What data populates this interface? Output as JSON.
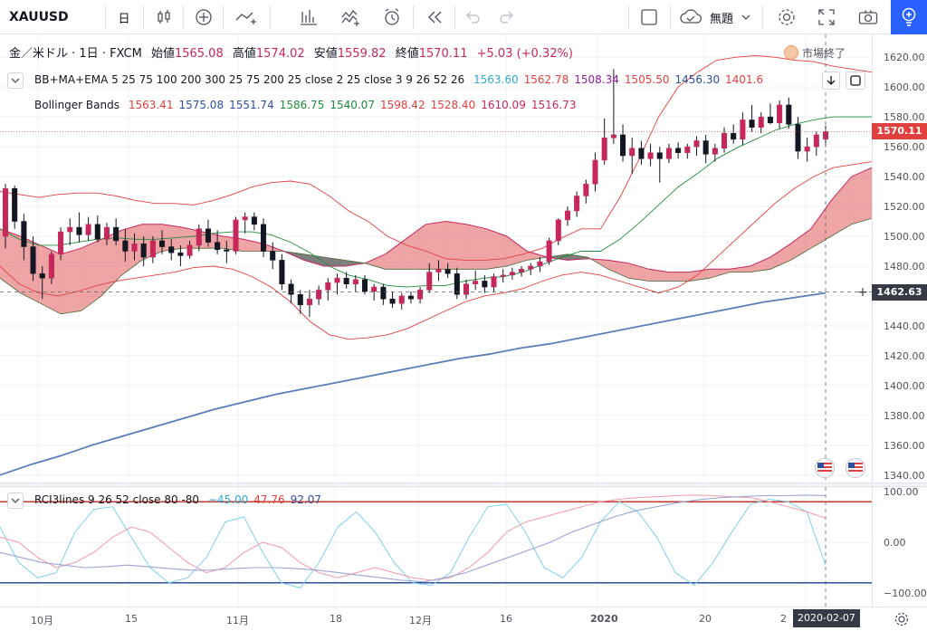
{
  "toolbar": {
    "symbol": "XAUUSD",
    "interval": "日",
    "template_label": "無題",
    "icons": [
      "candles-icon",
      "add-indicator-icon",
      "compare-icon",
      "bars-icon",
      "replay-icon",
      "alert-icon",
      "rewind-icon",
      "undo-icon",
      "redo-icon",
      "layout-icon",
      "cloud-save-icon",
      "settings-icon",
      "fullscreen-icon",
      "screenshot-icon",
      "ideas-icon"
    ]
  },
  "header": {
    "title": "金／米ドル · 1日 · FXCM",
    "open_label": "始値",
    "open": "1565.08",
    "high_label": "高値",
    "high": "1574.02",
    "low_label": "安値",
    "low": "1559.82",
    "close_label": "終値",
    "close": "1570.11",
    "change": "+5.03 (+0.32%)",
    "market_status": "市場終了"
  },
  "indicators": {
    "bbmaema": {
      "label": "BB+MA+EMA 5 25 75 100 200 300 25 75 200 25 close 2 25 close 3 9 26 52 26",
      "values": [
        {
          "v": "1563.60",
          "color": "#2ea8d3"
        },
        {
          "v": "1562.78",
          "color": "#e0413f"
        },
        {
          "v": "1508.34",
          "color": "#8c1fa0"
        },
        {
          "v": "1505.50",
          "color": "#e0413f"
        },
        {
          "v": "1456.30",
          "color": "#2e4fa0"
        },
        {
          "v": "1401.6",
          "color": "#e0413f"
        }
      ]
    },
    "bollinger": {
      "label": "Bollinger Bands",
      "values": [
        {
          "v": "1563.41",
          "color": "#e0413f"
        },
        {
          "v": "1575.08",
          "color": "#2e4fa0"
        },
        {
          "v": "1551.74",
          "color": "#2e4fa0"
        },
        {
          "v": "1586.75",
          "color": "#1e8c3c"
        },
        {
          "v": "1540.07",
          "color": "#1e8c3c"
        },
        {
          "v": "1598.42",
          "color": "#e0413f"
        },
        {
          "v": "1528.40",
          "color": "#e0413f"
        },
        {
          "v": "1610.09",
          "color": "#c6285c"
        },
        {
          "v": "1516.73",
          "color": "#c6285c"
        }
      ]
    },
    "rci": {
      "label": "RCI3lines 9 26 52 close 80 -80",
      "values": [
        {
          "v": "−45.00",
          "color": "#2ea8d3"
        },
        {
          "v": "47.76",
          "color": "#e0413f"
        },
        {
          "v": "92.07",
          "color": "#2e4fa0"
        }
      ]
    }
  },
  "price_axis": {
    "ticks": [
      "1620.00",
      "1600.00",
      "1580.00",
      "1560.00",
      "1540.00",
      "1520.00",
      "1500.00",
      "1480.00",
      "1460.00",
      "1440.00",
      "1420.00",
      "1400.00",
      "1380.00",
      "1360.00",
      "1340.00"
    ],
    "last_price": "1570.11",
    "crosshair_price": "1462.63"
  },
  "rci_axis": {
    "ticks": [
      "100.00",
      "0.00",
      "−100.00"
    ]
  },
  "time_axis": {
    "ticks": [
      "10月",
      "15",
      "11月",
      "18",
      "12月",
      "16",
      "2020",
      "20",
      "2"
    ],
    "crosshair_date": "2020-02-07"
  },
  "chart_data": {
    "type": "candlestick",
    "symbol": "XAUUSD",
    "ylim": [
      1335,
      1628
    ],
    "candles": [
      {
        "o": 1500,
        "h": 1535,
        "l": 1492,
        "c": 1532
      },
      {
        "o": 1532,
        "h": 1534,
        "l": 1505,
        "c": 1510
      },
      {
        "o": 1510,
        "h": 1515,
        "l": 1484,
        "c": 1493
      },
      {
        "o": 1493,
        "h": 1500,
        "l": 1470,
        "c": 1475
      },
      {
        "o": 1475,
        "h": 1480,
        "l": 1458,
        "c": 1472
      },
      {
        "o": 1472,
        "h": 1490,
        "l": 1468,
        "c": 1488
      },
      {
        "o": 1488,
        "h": 1506,
        "l": 1484,
        "c": 1503
      },
      {
        "o": 1503,
        "h": 1512,
        "l": 1494,
        "c": 1506
      },
      {
        "o": 1506,
        "h": 1516,
        "l": 1496,
        "c": 1501
      },
      {
        "o": 1501,
        "h": 1513,
        "l": 1497,
        "c": 1508
      },
      {
        "o": 1508,
        "h": 1514,
        "l": 1496,
        "c": 1498
      },
      {
        "o": 1498,
        "h": 1509,
        "l": 1494,
        "c": 1506
      },
      {
        "o": 1506,
        "h": 1512,
        "l": 1494,
        "c": 1497
      },
      {
        "o": 1497,
        "h": 1505,
        "l": 1483,
        "c": 1490
      },
      {
        "o": 1490,
        "h": 1502,
        "l": 1484,
        "c": 1495
      },
      {
        "o": 1495,
        "h": 1500,
        "l": 1480,
        "c": 1486
      },
      {
        "o": 1486,
        "h": 1500,
        "l": 1482,
        "c": 1497
      },
      {
        "o": 1497,
        "h": 1504,
        "l": 1488,
        "c": 1493
      },
      {
        "o": 1493,
        "h": 1498,
        "l": 1484,
        "c": 1489
      },
      {
        "o": 1489,
        "h": 1494,
        "l": 1480,
        "c": 1487
      },
      {
        "o": 1487,
        "h": 1497,
        "l": 1485,
        "c": 1494
      },
      {
        "o": 1494,
        "h": 1508,
        "l": 1490,
        "c": 1505
      },
      {
        "o": 1505,
        "h": 1511,
        "l": 1493,
        "c": 1496
      },
      {
        "o": 1496,
        "h": 1504,
        "l": 1488,
        "c": 1491
      },
      {
        "o": 1491,
        "h": 1497,
        "l": 1482,
        "c": 1490
      },
      {
        "o": 1490,
        "h": 1513,
        "l": 1488,
        "c": 1511
      },
      {
        "o": 1511,
        "h": 1516,
        "l": 1502,
        "c": 1513
      },
      {
        "o": 1513,
        "h": 1516,
        "l": 1504,
        "c": 1508
      },
      {
        "o": 1508,
        "h": 1512,
        "l": 1486,
        "c": 1490
      },
      {
        "o": 1490,
        "h": 1496,
        "l": 1478,
        "c": 1484
      },
      {
        "o": 1484,
        "h": 1488,
        "l": 1464,
        "c": 1468
      },
      {
        "o": 1468,
        "h": 1471,
        "l": 1455,
        "c": 1461
      },
      {
        "o": 1461,
        "h": 1464,
        "l": 1448,
        "c": 1454
      },
      {
        "o": 1454,
        "h": 1464,
        "l": 1446,
        "c": 1458
      },
      {
        "o": 1458,
        "h": 1467,
        "l": 1454,
        "c": 1464
      },
      {
        "o": 1464,
        "h": 1472,
        "l": 1457,
        "c": 1469
      },
      {
        "o": 1469,
        "h": 1475,
        "l": 1461,
        "c": 1472
      },
      {
        "o": 1472,
        "h": 1476,
        "l": 1465,
        "c": 1468
      },
      {
        "o": 1468,
        "h": 1474,
        "l": 1463,
        "c": 1471
      },
      {
        "o": 1471,
        "h": 1474,
        "l": 1461,
        "c": 1463
      },
      {
        "o": 1463,
        "h": 1468,
        "l": 1457,
        "c": 1466
      },
      {
        "o": 1466,
        "h": 1468,
        "l": 1454,
        "c": 1458
      },
      {
        "o": 1458,
        "h": 1463,
        "l": 1452,
        "c": 1455
      },
      {
        "o": 1455,
        "h": 1462,
        "l": 1451,
        "c": 1460
      },
      {
        "o": 1460,
        "h": 1463,
        "l": 1455,
        "c": 1458
      },
      {
        "o": 1458,
        "h": 1466,
        "l": 1455,
        "c": 1464
      },
      {
        "o": 1464,
        "h": 1482,
        "l": 1462,
        "c": 1476
      },
      {
        "o": 1476,
        "h": 1484,
        "l": 1470,
        "c": 1478
      },
      {
        "o": 1478,
        "h": 1482,
        "l": 1472,
        "c": 1475
      },
      {
        "o": 1475,
        "h": 1479,
        "l": 1458,
        "c": 1461
      },
      {
        "o": 1461,
        "h": 1471,
        "l": 1458,
        "c": 1468
      },
      {
        "o": 1468,
        "h": 1477,
        "l": 1464,
        "c": 1470
      },
      {
        "o": 1470,
        "h": 1474,
        "l": 1462,
        "c": 1466
      },
      {
        "o": 1466,
        "h": 1475,
        "l": 1463,
        "c": 1473
      },
      {
        "o": 1473,
        "h": 1478,
        "l": 1469,
        "c": 1474
      },
      {
        "o": 1474,
        "h": 1479,
        "l": 1471,
        "c": 1476
      },
      {
        "o": 1476,
        "h": 1480,
        "l": 1473,
        "c": 1478
      },
      {
        "o": 1478,
        "h": 1482,
        "l": 1474,
        "c": 1480
      },
      {
        "o": 1480,
        "h": 1486,
        "l": 1476,
        "c": 1483
      },
      {
        "o": 1483,
        "h": 1499,
        "l": 1481,
        "c": 1497
      },
      {
        "o": 1497,
        "h": 1512,
        "l": 1494,
        "c": 1511
      },
      {
        "o": 1511,
        "h": 1520,
        "l": 1507,
        "c": 1517
      },
      {
        "o": 1517,
        "h": 1530,
        "l": 1513,
        "c": 1527
      },
      {
        "o": 1527,
        "h": 1538,
        "l": 1522,
        "c": 1535
      },
      {
        "o": 1535,
        "h": 1556,
        "l": 1530,
        "c": 1551
      },
      {
        "o": 1551,
        "h": 1579,
        "l": 1548,
        "c": 1566
      },
      {
        "o": 1566,
        "h": 1612,
        "l": 1562,
        "c": 1568
      },
      {
        "o": 1568,
        "h": 1575,
        "l": 1550,
        "c": 1554
      },
      {
        "o": 1554,
        "h": 1566,
        "l": 1542,
        "c": 1559
      },
      {
        "o": 1559,
        "h": 1564,
        "l": 1548,
        "c": 1552
      },
      {
        "o": 1552,
        "h": 1562,
        "l": 1547,
        "c": 1556
      },
      {
        "o": 1556,
        "h": 1560,
        "l": 1536,
        "c": 1552
      },
      {
        "o": 1552,
        "h": 1562,
        "l": 1549,
        "c": 1559
      },
      {
        "o": 1559,
        "h": 1563,
        "l": 1552,
        "c": 1556
      },
      {
        "o": 1556,
        "h": 1562,
        "l": 1552,
        "c": 1560
      },
      {
        "o": 1560,
        "h": 1567,
        "l": 1554,
        "c": 1564
      },
      {
        "o": 1564,
        "h": 1568,
        "l": 1549,
        "c": 1555
      },
      {
        "o": 1555,
        "h": 1562,
        "l": 1550,
        "c": 1559
      },
      {
        "o": 1559,
        "h": 1573,
        "l": 1556,
        "c": 1569
      },
      {
        "o": 1569,
        "h": 1575,
        "l": 1562,
        "c": 1565
      },
      {
        "o": 1565,
        "h": 1583,
        "l": 1561,
        "c": 1578
      },
      {
        "o": 1578,
        "h": 1588,
        "l": 1570,
        "c": 1573
      },
      {
        "o": 1573,
        "h": 1583,
        "l": 1569,
        "c": 1580
      },
      {
        "o": 1580,
        "h": 1589,
        "l": 1575,
        "c": 1576
      },
      {
        "o": 1576,
        "h": 1591,
        "l": 1572,
        "c": 1588
      },
      {
        "o": 1588,
        "h": 1593,
        "l": 1572,
        "c": 1575
      },
      {
        "o": 1575,
        "h": 1580,
        "l": 1552,
        "c": 1557
      },
      {
        "o": 1557,
        "h": 1566,
        "l": 1550,
        "c": 1560
      },
      {
        "o": 1560,
        "h": 1570,
        "l": 1554,
        "c": 1568
      },
      {
        "o": 1565.08,
        "h": 1574.02,
        "l": 1559.82,
        "c": 1570.11
      }
    ],
    "bollinger_upper": [
      1530,
      1528,
      1526,
      1528,
      1529,
      1529,
      1527,
      1524,
      1522,
      1522,
      1521,
      1524,
      1528,
      1533,
      1536,
      1537,
      1535,
      1527,
      1517,
      1510,
      1500,
      1494,
      1490,
      1485,
      1484,
      1484,
      1485,
      1488,
      1492,
      1499,
      1505,
      1505,
      1526,
      1552,
      1580,
      1600,
      1610,
      1618,
      1620,
      1621,
      1620,
      1618,
      1617,
      1614,
      1612,
      1610
    ],
    "bollinger_lower": [
      1480,
      1468,
      1462,
      1460,
      1463,
      1467,
      1470,
      1472,
      1474,
      1476,
      1479,
      1480,
      1478,
      1473,
      1466,
      1456,
      1443,
      1434,
      1431,
      1432,
      1434,
      1438,
      1444,
      1450,
      1456,
      1460,
      1462,
      1465,
      1470,
      1474,
      1476,
      1474,
      1470,
      1466,
      1462,
      1466,
      1474,
      1486,
      1498,
      1510,
      1522,
      1532,
      1540,
      1546,
      1548,
      1550
    ],
    "bollinger_mid": [
      1505,
      1498,
      1494,
      1494,
      1496,
      1498,
      1499,
      1498,
      1498,
      1499,
      1500,
      1502,
      1503,
      1503,
      1501,
      1496,
      1489,
      1480,
      1474,
      1471,
      1467,
      1466,
      1467,
      1467,
      1470,
      1472,
      1473,
      1476,
      1481,
      1486,
      1490,
      1490,
      1498,
      1509,
      1521,
      1533,
      1542,
      1552,
      1559,
      1565,
      1571,
      1575,
      1578,
      1580,
      1580,
      1580
    ],
    "ma_long": [
      1340,
      1347,
      1353,
      1360,
      1366,
      1372,
      1378,
      1384,
      1389,
      1394,
      1398,
      1402,
      1406,
      1410,
      1414,
      1418,
      1421,
      1425,
      1428,
      1432,
      1436,
      1440,
      1444,
      1448,
      1452,
      1456,
      1459,
      1462
    ],
    "ichimoku_span_a": [
      1505,
      1500,
      1494,
      1488,
      1492,
      1498,
      1504,
      1508,
      1508,
      1506,
      1503,
      1500,
      1498,
      1495,
      1490,
      1484,
      1480,
      1480,
      1482,
      1488,
      1498,
      1508,
      1510,
      1508,
      1505,
      1500,
      1490,
      1486,
      1484,
      1485,
      1484,
      1482,
      1478,
      1476,
      1476,
      1478,
      1478,
      1480,
      1486,
      1495,
      1505,
      1524,
      1540,
      1546
    ],
    "ichimoku_span_b": [
      1472,
      1462,
      1455,
      1448,
      1450,
      1460,
      1474,
      1484,
      1490,
      1492,
      1492,
      1492,
      1490,
      1490,
      1490,
      1488,
      1486,
      1484,
      1482,
      1478,
      1478,
      1478,
      1478,
      1478,
      1478,
      1480,
      1484,
      1486,
      1488,
      1486,
      1478,
      1472,
      1470,
      1470,
      1470,
      1472,
      1476,
      1476,
      1478,
      1484,
      1492,
      1500,
      1508,
      1512
    ],
    "rci_short": [
      30,
      -40,
      -70,
      -60,
      20,
      65,
      70,
      10,
      -50,
      -80,
      -70,
      -30,
      40,
      50,
      -20,
      -80,
      -90,
      -40,
      30,
      60,
      20,
      -40,
      -80,
      -85,
      -60,
      10,
      70,
      75,
      20,
      -50,
      -70,
      -30,
      40,
      80,
      60,
      10,
      -60,
      -85,
      -40,
      20,
      75,
      85,
      80,
      60,
      -45
    ],
    "rci_mid": [
      10,
      0,
      -30,
      -50,
      -40,
      -20,
      10,
      30,
      20,
      -10,
      -40,
      -60,
      -50,
      -20,
      0,
      -10,
      -40,
      -60,
      -70,
      -60,
      -50,
      -60,
      -70,
      -75,
      -70,
      -50,
      -20,
      20,
      40,
      50,
      60,
      70,
      80,
      85,
      88,
      90,
      92,
      93,
      92,
      90,
      88,
      80,
      70,
      60,
      47.76
    ],
    "rci_long": [
      -20,
      -30,
      -40,
      -45,
      -50,
      -48,
      -45,
      -48,
      -52,
      -55,
      -55,
      -52,
      -50,
      -50,
      -52,
      -55,
      -60,
      -65,
      -70,
      -75,
      -78,
      -70,
      -60,
      -45,
      -30,
      -15,
      0,
      20,
      35,
      50,
      62,
      70,
      78,
      84,
      88,
      90,
      92,
      92,
      93,
      92.07
    ]
  }
}
